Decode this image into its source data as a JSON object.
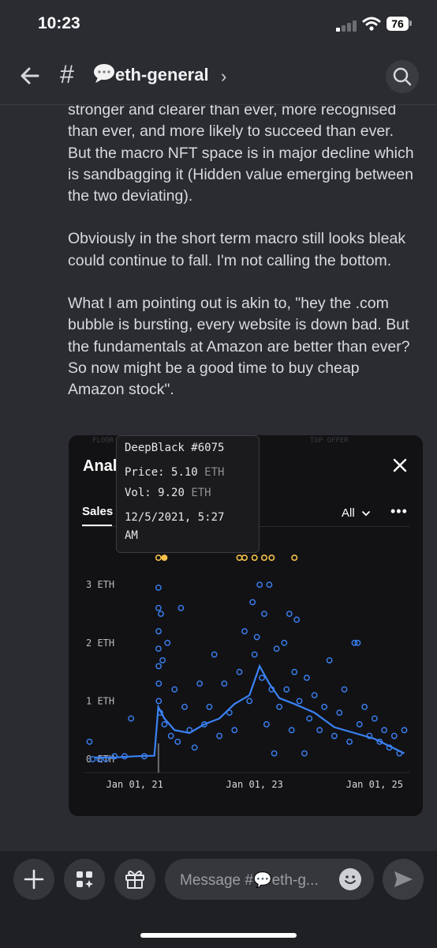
{
  "status_bar": {
    "time": "10:23",
    "battery": "76"
  },
  "header": {
    "channel_name": "eth-general",
    "hash": "#",
    "chevron": "›"
  },
  "message": {
    "paragraphs": [
      "stronger and clearer than ever, more recognised than ever, and more likely to succeed than ever. But the macro NFT space is in major decline which is sandbagging it (Hidden value emerging between the two deviating).",
      "Obviously in the short term macro still looks bleak could continue to fall. I'm not calling the bottom.",
      "What I am pointing out is akin to, \"hey the .com bubble is bursting, every website is down bad. But the fundamentals at Amazon are better than ever? So now might be a good time to buy cheap Amazon stock\"."
    ]
  },
  "embed": {
    "title": "Anal",
    "tab_sales": "Sales",
    "filter": "All",
    "more": "•••",
    "header_fragments": [
      "FLOOR",
      "TOP OFFER"
    ]
  },
  "tooltip": {
    "item": "DeepBlack #6075",
    "price_label": "Price:",
    "price_value": "5.10",
    "price_unit": "ETH",
    "vol_label": "Vol:",
    "vol_value": "9.20",
    "vol_unit": "ETH",
    "datetime_line1": "12/5/2021, 5:27",
    "datetime_line2": "AM"
  },
  "composer": {
    "placeholder": "Message #💬eth-g..."
  },
  "colors": {
    "accent": "#3b82f6",
    "highlight": "#f5c04a",
    "bg": "#2b2c31"
  },
  "icons": [
    "back-arrow-icon",
    "hash-icon",
    "speech-bubble-icon",
    "chevron-right-icon",
    "search-icon",
    "close-icon",
    "chevron-down-icon",
    "plus-icon",
    "apps-icon",
    "gift-icon",
    "emoji-icon",
    "send-icon"
  ],
  "chart_data": {
    "type": "scatter",
    "title": "",
    "xlabel": "",
    "ylabel": "",
    "x_tick_labels": [
      "Jan 01, 21",
      "Jan 01, 23",
      "Jan 01, 25"
    ],
    "y_tick_labels": [
      "3 ETH",
      "2 ETH",
      "1 ETH",
      "0 ETH"
    ],
    "ylim": [
      0,
      3.6
    ],
    "xlim": [
      "2020-03-01",
      "2025-08-01"
    ],
    "series": [
      {
        "kind": "average_line",
        "points": [
          [
            "2020-05-01",
            0.03
          ],
          [
            "2020-09-01",
            0.03
          ],
          [
            "2021-01-01",
            0.05
          ],
          [
            "2021-05-01",
            0.06
          ],
          [
            "2021-05-25",
            0.9
          ],
          [
            "2021-07-01",
            0.7
          ],
          [
            "2021-09-01",
            0.5
          ],
          [
            "2021-12-01",
            0.45
          ],
          [
            "2022-03-01",
            0.6
          ],
          [
            "2022-06-01",
            0.7
          ],
          [
            "2022-09-01",
            0.95
          ],
          [
            "2022-12-01",
            1.1
          ],
          [
            "2023-02-01",
            1.6
          ],
          [
            "2023-04-01",
            1.3
          ],
          [
            "2023-06-01",
            1.05
          ],
          [
            "2023-09-01",
            0.95
          ],
          [
            "2024-01-01",
            0.8
          ],
          [
            "2024-05-01",
            0.55
          ],
          [
            "2024-09-01",
            0.45
          ],
          [
            "2025-01-01",
            0.35
          ],
          [
            "2025-07-01",
            0.1
          ]
        ]
      },
      {
        "kind": "sales",
        "points": [
          [
            "2020-04-01",
            0.3
          ],
          [
            "2020-04-20",
            0.0
          ],
          [
            "2020-06-01",
            0.0
          ],
          [
            "2020-07-10",
            0.0
          ],
          [
            "2020-09-01",
            0.05
          ],
          [
            "2020-11-01",
            0.05
          ],
          [
            "2020-12-10",
            0.7
          ],
          [
            "2021-03-01",
            0.05
          ],
          [
            "2021-05-26",
            1.9
          ],
          [
            "2021-05-26",
            2.6
          ],
          [
            "2021-05-26",
            2.95
          ],
          [
            "2021-05-27",
            2.2
          ],
          [
            "2021-05-27",
            1.6
          ],
          [
            "2021-05-28",
            1.3
          ],
          [
            "2021-05-28",
            1.0
          ],
          [
            "2021-06-05",
            0.8
          ],
          [
            "2021-06-10",
            2.5
          ],
          [
            "2021-06-20",
            1.7
          ],
          [
            "2021-07-01",
            0.6
          ],
          [
            "2021-07-20",
            2.0
          ],
          [
            "2021-08-10",
            0.4
          ],
          [
            "2021-09-01",
            1.2
          ],
          [
            "2021-09-20",
            0.3
          ],
          [
            "2021-10-10",
            2.6
          ],
          [
            "2021-11-01",
            0.9
          ],
          [
            "2021-12-01",
            0.5
          ],
          [
            "2022-01-01",
            0.2
          ],
          [
            "2022-02-01",
            1.3
          ],
          [
            "2022-03-01",
            0.6
          ],
          [
            "2022-04-01",
            0.9
          ],
          [
            "2022-05-01",
            1.8
          ],
          [
            "2022-06-01",
            0.4
          ],
          [
            "2022-07-01",
            1.3
          ],
          [
            "2022-08-01",
            0.8
          ],
          [
            "2022-09-01",
            0.5
          ],
          [
            "2022-10-01",
            1.5
          ],
          [
            "2022-11-01",
            2.2
          ],
          [
            "2022-12-01",
            1.0
          ],
          [
            "2022-12-20",
            2.7
          ],
          [
            "2023-01-01",
            1.8
          ],
          [
            "2023-01-15",
            2.1
          ],
          [
            "2023-02-01",
            3.0
          ],
          [
            "2023-02-15",
            1.4
          ],
          [
            "2023-03-01",
            2.5
          ],
          [
            "2023-03-15",
            0.6
          ],
          [
            "2023-04-01",
            3.0
          ],
          [
            "2023-04-15",
            1.2
          ],
          [
            "2023-05-01",
            0.1
          ],
          [
            "2023-05-15",
            1.9
          ],
          [
            "2023-06-01",
            0.9
          ],
          [
            "2023-07-01",
            2.0
          ],
          [
            "2023-07-15",
            1.2
          ],
          [
            "2023-08-01",
            2.5
          ],
          [
            "2023-08-15",
            0.5
          ],
          [
            "2023-09-01",
            1.5
          ],
          [
            "2023-09-15",
            2.4
          ],
          [
            "2023-10-01",
            1.0
          ],
          [
            "2023-11-01",
            0.1
          ],
          [
            "2023-11-15",
            1.4
          ],
          [
            "2023-12-01",
            0.7
          ],
          [
            "2024-01-01",
            1.1
          ],
          [
            "2024-02-01",
            0.5
          ],
          [
            "2024-03-01",
            0.9
          ],
          [
            "2024-04-01",
            1.7
          ],
          [
            "2024-05-01",
            0.4
          ],
          [
            "2024-06-01",
            0.8
          ],
          [
            "2024-07-01",
            1.2
          ],
          [
            "2024-08-01",
            0.3
          ],
          [
            "2024-09-01",
            2.0
          ],
          [
            "2024-09-20",
            2.0
          ],
          [
            "2024-10-01",
            0.6
          ],
          [
            "2024-11-01",
            0.9
          ],
          [
            "2024-12-01",
            0.4
          ],
          [
            "2025-01-01",
            0.7
          ],
          [
            "2025-02-01",
            0.3
          ],
          [
            "2025-03-01",
            0.5
          ],
          [
            "2025-04-01",
            0.2
          ],
          [
            "2025-05-01",
            0.4
          ],
          [
            "2025-06-01",
            0.1
          ],
          [
            "2025-07-01",
            0.5
          ]
        ]
      },
      {
        "kind": "sales_above_range",
        "points": [
          [
            "2021-05-26",
            3.55
          ],
          [
            "2021-07-01",
            3.55
          ],
          [
            "2022-10-01",
            3.55
          ],
          [
            "2022-11-01",
            3.55
          ],
          [
            "2023-01-01",
            3.55
          ],
          [
            "2023-03-01",
            3.55
          ],
          [
            "2023-04-15",
            3.55
          ],
          [
            "2023-09-01",
            3.55
          ]
        ]
      }
    ]
  }
}
